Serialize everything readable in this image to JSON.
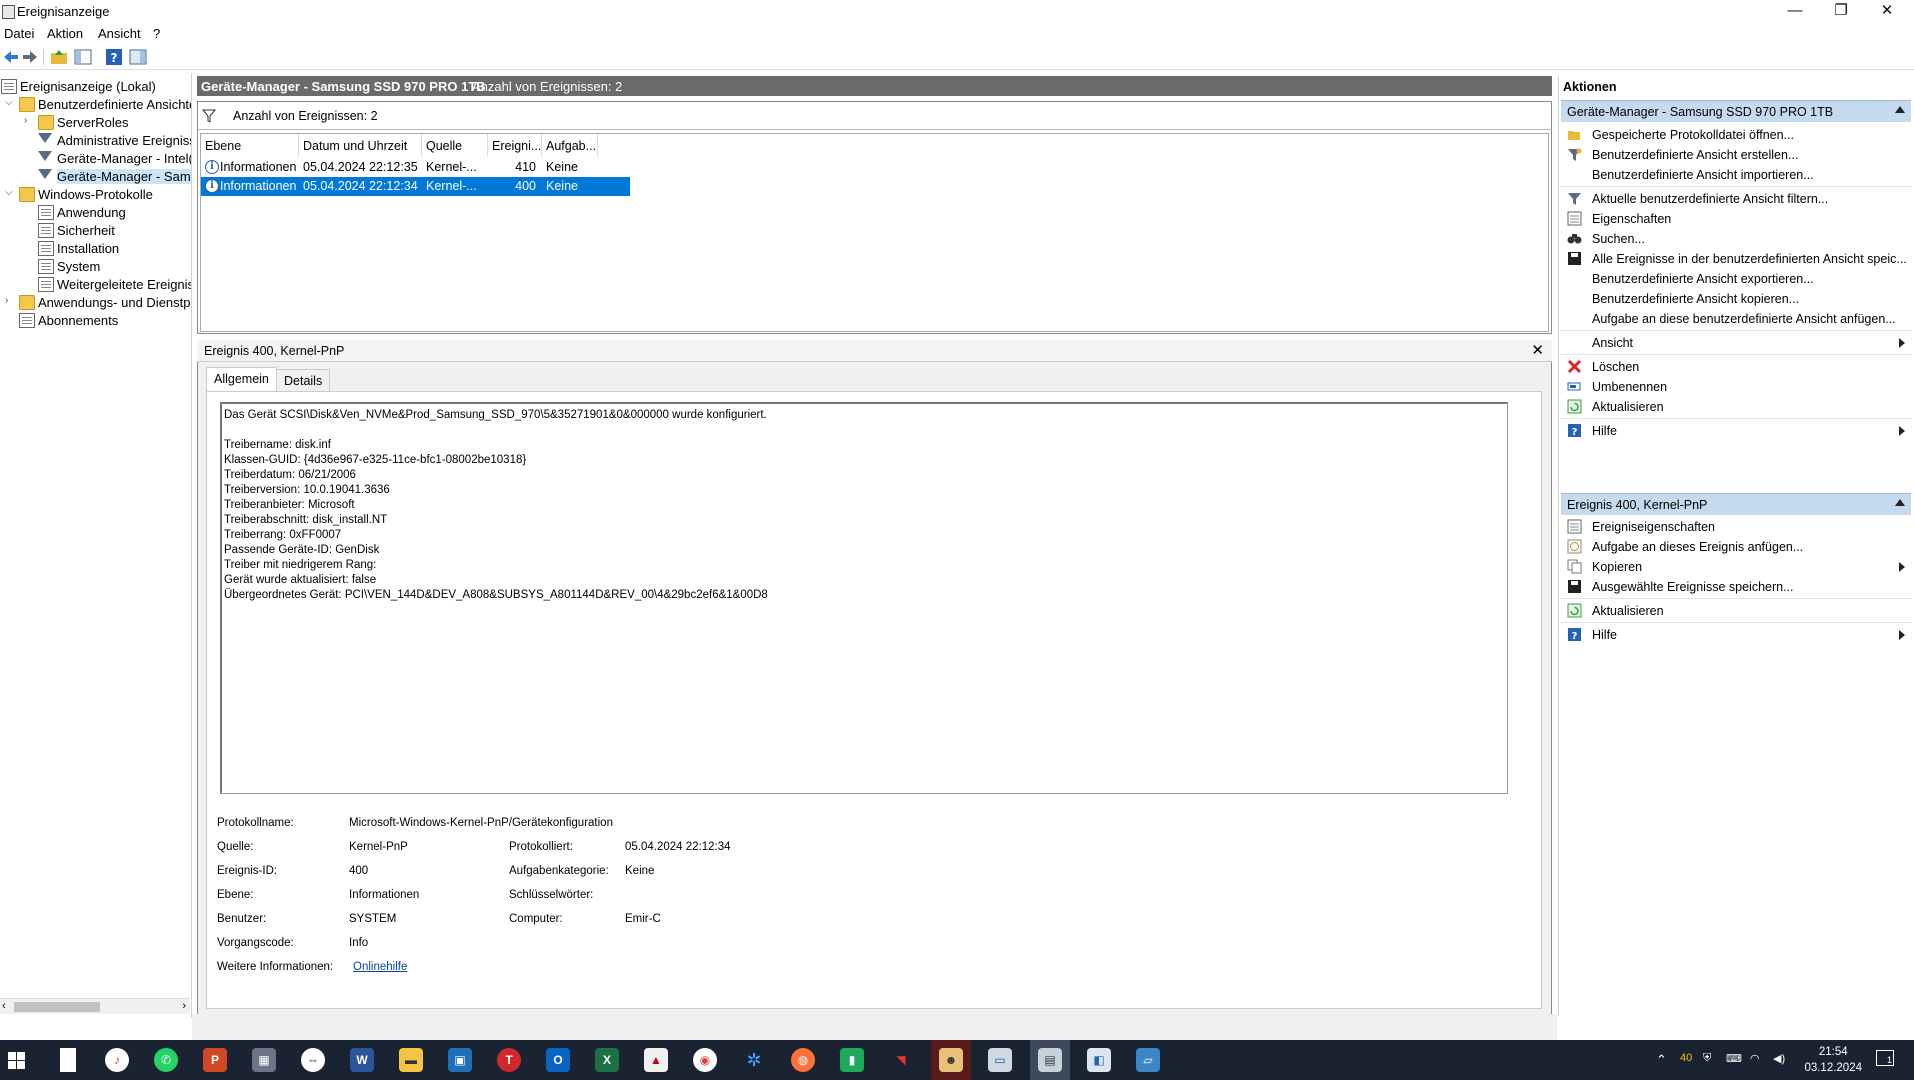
{
  "window": {
    "title": "Ereignisanzeige",
    "minimize": "—",
    "restore": "❐",
    "close": "✕"
  },
  "menu": [
    "Datei",
    "Aktion",
    "Ansicht",
    "?"
  ],
  "tree": {
    "root": "Ereignisanzeige (Lokal)",
    "custom_views": "Benutzerdefinierte Ansichten",
    "server_roles": "ServerRoles",
    "admin_events": "Administrative Ereignisse",
    "dm_intel": "Geräte-Manager - Intel(R",
    "dm_samsung": "Geräte-Manager - Samsu",
    "windows_logs": "Windows-Protokolle",
    "application": "Anwendung",
    "security": "Sicherheit",
    "installation": "Installation",
    "system": "System",
    "forwarded": "Weitergeleitete Ereignisse",
    "app_services": "Anwendungs- und Dienstpro",
    "subscriptions": "Abonnements"
  },
  "center": {
    "header_title": "Geräte-Manager - Samsung SSD 970 PRO 1TB",
    "header_count": "Anzahl von Ereignissen: 2",
    "filter_text": "Anzahl von Ereignissen: 2",
    "columns": [
      "Ebene",
      "Datum und Uhrzeit",
      "Quelle",
      "Ereigni...",
      "Aufgab..."
    ],
    "rows": [
      {
        "level": "Informationen",
        "datetime": "05.04.2024 22:12:35",
        "source": "Kernel-...",
        "id": "410",
        "task": "Keine"
      },
      {
        "level": "Informationen",
        "datetime": "05.04.2024 22:12:34",
        "source": "Kernel-...",
        "id": "400",
        "task": "Keine"
      }
    ]
  },
  "detail": {
    "title": "Ereignis 400, Kernel-PnP",
    "close": "✕",
    "tabs": [
      "Allgemein",
      "Details"
    ],
    "description": [
      "Das Gerät SCSI\\Disk&Ven_NVMe&Prod_Samsung_SSD_970\\5&35271901&0&000000 wurde konfiguriert.",
      "",
      "Treibername: disk.inf",
      "Klassen-GUID: {4d36e967-e325-11ce-bfc1-08002be10318}",
      "Treiberdatum: 06/21/2006",
      "Treiberversion: 10.0.19041.3636",
      "Treiberanbieter: Microsoft",
      "Treiberabschnitt: disk_install.NT",
      "Treiberrang: 0xFF0007",
      "Passende Geräte-ID: GenDisk",
      "Treiber mit niedrigerem Rang:",
      "Gerät wurde aktualisiert: false",
      "Übergeordnetes Gerät: PCI\\VEN_144D&DEV_A808&SUBSYS_A801144D&REV_00\\4&29bc2ef6&1&00D8"
    ],
    "props": {
      "log_name_label": "Protokollname:",
      "log_name": "Microsoft-Windows-Kernel-PnP/Gerätekonfiguration",
      "source_label": "Quelle:",
      "source": "Kernel-PnP",
      "logged_label": "Protokolliert:",
      "logged": "05.04.2024 22:12:34",
      "event_id_label": "Ereignis-ID:",
      "event_id": "400",
      "task_label": "Aufgabenkategorie:",
      "task": "Keine",
      "level_label": "Ebene:",
      "level": "Informationen",
      "keywords_label": "Schlüsselwörter:",
      "keywords": "",
      "user_label": "Benutzer:",
      "user": "SYSTEM",
      "computer_label": "Computer:",
      "computer": "Emir-C",
      "opcode_label": "Vorgangscode:",
      "opcode": "Info",
      "more_info_label": "Weitere Informationen:",
      "more_info_link": "Onlinehilfe"
    }
  },
  "actions": {
    "title": "Aktionen",
    "section1": "Geräte-Manager - Samsung SSD 970 PRO 1TB",
    "items1": [
      "Gespeicherte Protokolldatei öffnen...",
      "Benutzerdefinierte Ansicht erstellen...",
      "Benutzerdefinierte Ansicht importieren...",
      "Aktuelle benutzerdefinierte Ansicht filtern...",
      "Eigenschaften",
      "Suchen...",
      "Alle Ereignisse in der benutzerdefinierten Ansicht speic...",
      "Benutzerdefinierte Ansicht exportieren...",
      "Benutzerdefinierte Ansicht kopieren...",
      "Aufgabe an diese benutzerdefinierte Ansicht anfügen...",
      "Ansicht",
      "Löschen",
      "Umbenennen",
      "Aktualisieren",
      "Hilfe"
    ],
    "section2": "Ereignis 400, Kernel-PnP",
    "items2": [
      "Ereigniseigenschaften",
      "Aufgabe an dieses Ereignis anfügen...",
      "Kopieren",
      "Ausgewählte Ereignisse speichern...",
      "Aktualisieren",
      "Hilfe"
    ]
  },
  "taskbar": {
    "time": "21:54",
    "date": "03.12.2024",
    "tray_count": "40",
    "notification_count": "1"
  }
}
